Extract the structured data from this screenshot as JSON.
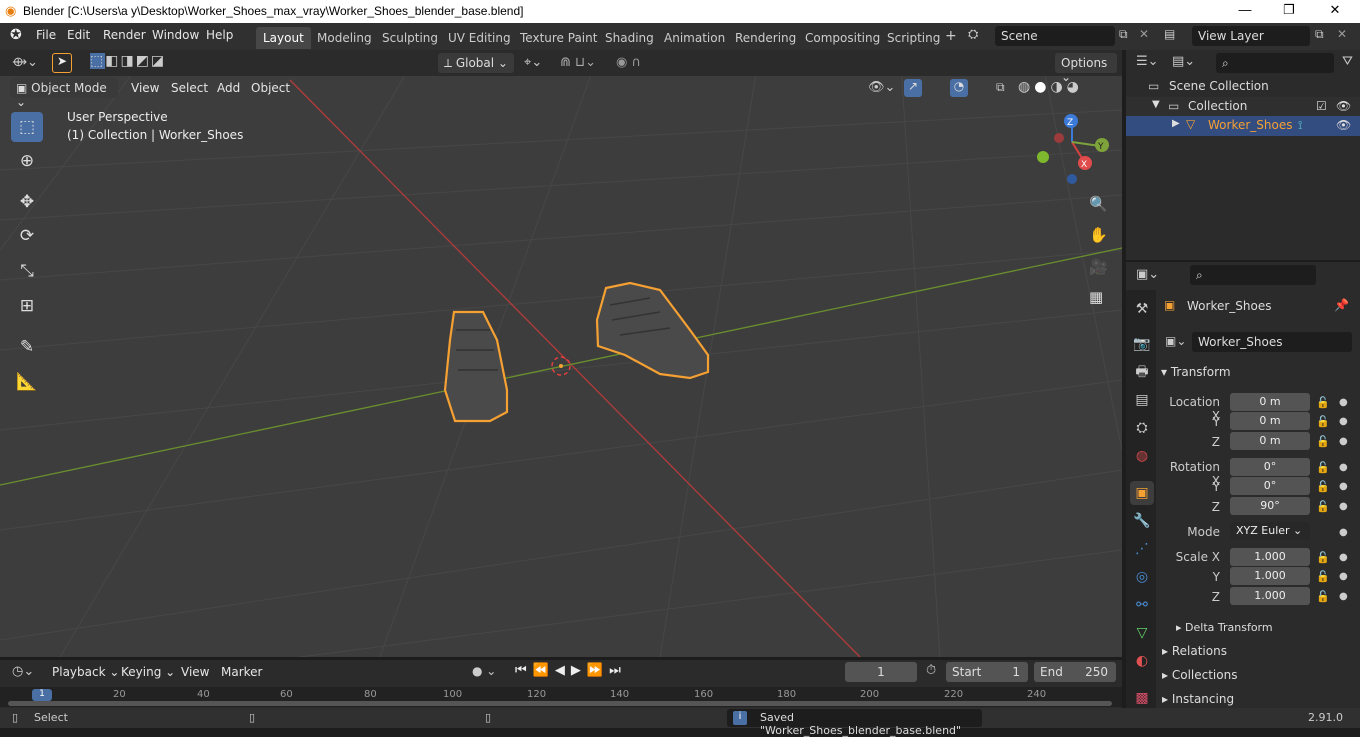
{
  "window": {
    "title": "Blender [C:\\Users\\a y\\Desktop\\Worker_Shoes_max_vray\\Worker_Shoes_blender_base.blend]",
    "min": "—",
    "max": "❐",
    "close": "✕"
  },
  "menu": [
    "File",
    "Edit",
    "Render",
    "Window",
    "Help"
  ],
  "workspaces": [
    "Layout",
    "Modeling",
    "Sculpting",
    "UV Editing",
    "Texture Paint",
    "Shading",
    "Animation",
    "Rendering",
    "Compositing",
    "Scripting"
  ],
  "scene": {
    "name": "Scene",
    "view_layer": "View Layer"
  },
  "header": {
    "orientation": "Global",
    "options": "Options",
    "mode": "Object Mode",
    "view": "View",
    "select": "Select",
    "add": "Add",
    "object": "Object"
  },
  "viewport": {
    "perspective": "User Perspective",
    "collection_info": "(1) Collection | Worker_Shoes"
  },
  "outliner": {
    "scene_collection": "Scene Collection",
    "collection": "Collection",
    "object": "Worker_Shoes"
  },
  "properties": {
    "object_name": "Worker_Shoes",
    "data_name": "Worker_Shoes",
    "transform": "Transform",
    "location_x_label": "Location X",
    "y_label": "Y",
    "z_label": "Z",
    "rotation_x_label": "Rotation X",
    "loc_x": "0 m",
    "loc_y": "0 m",
    "loc_z": "0 m",
    "rot_x": "0°",
    "rot_y": "0°",
    "rot_z": "90°",
    "mode_label": "Mode",
    "mode_value": "XYZ Euler",
    "scale_x_label": "Scale X",
    "scale_x": "1.000",
    "scale_y": "1.000",
    "scale_z": "1.000",
    "delta": "Delta Transform",
    "relations": "Relations",
    "collections": "Collections",
    "instancing": "Instancing"
  },
  "timeline": {
    "playback": "Playback",
    "keying": "Keying",
    "view": "View",
    "marker": "Marker",
    "current_frame": "1",
    "start_label": "Start",
    "start": "1",
    "end_label": "End",
    "end": "250",
    "ticks": [
      "1",
      "20",
      "40",
      "60",
      "80",
      "100",
      "120",
      "140",
      "160",
      "180",
      "200",
      "220",
      "240"
    ]
  },
  "status": {
    "select": "Select",
    "message": "Saved \"Worker_Shoes_blender_base.blend\"",
    "version": "2.91.0"
  },
  "colors": {
    "selection_outline": "#f5a033",
    "axis_x": "#b33b3b",
    "axis_y": "#6a8f2e",
    "accent": "#4a6fa5"
  }
}
